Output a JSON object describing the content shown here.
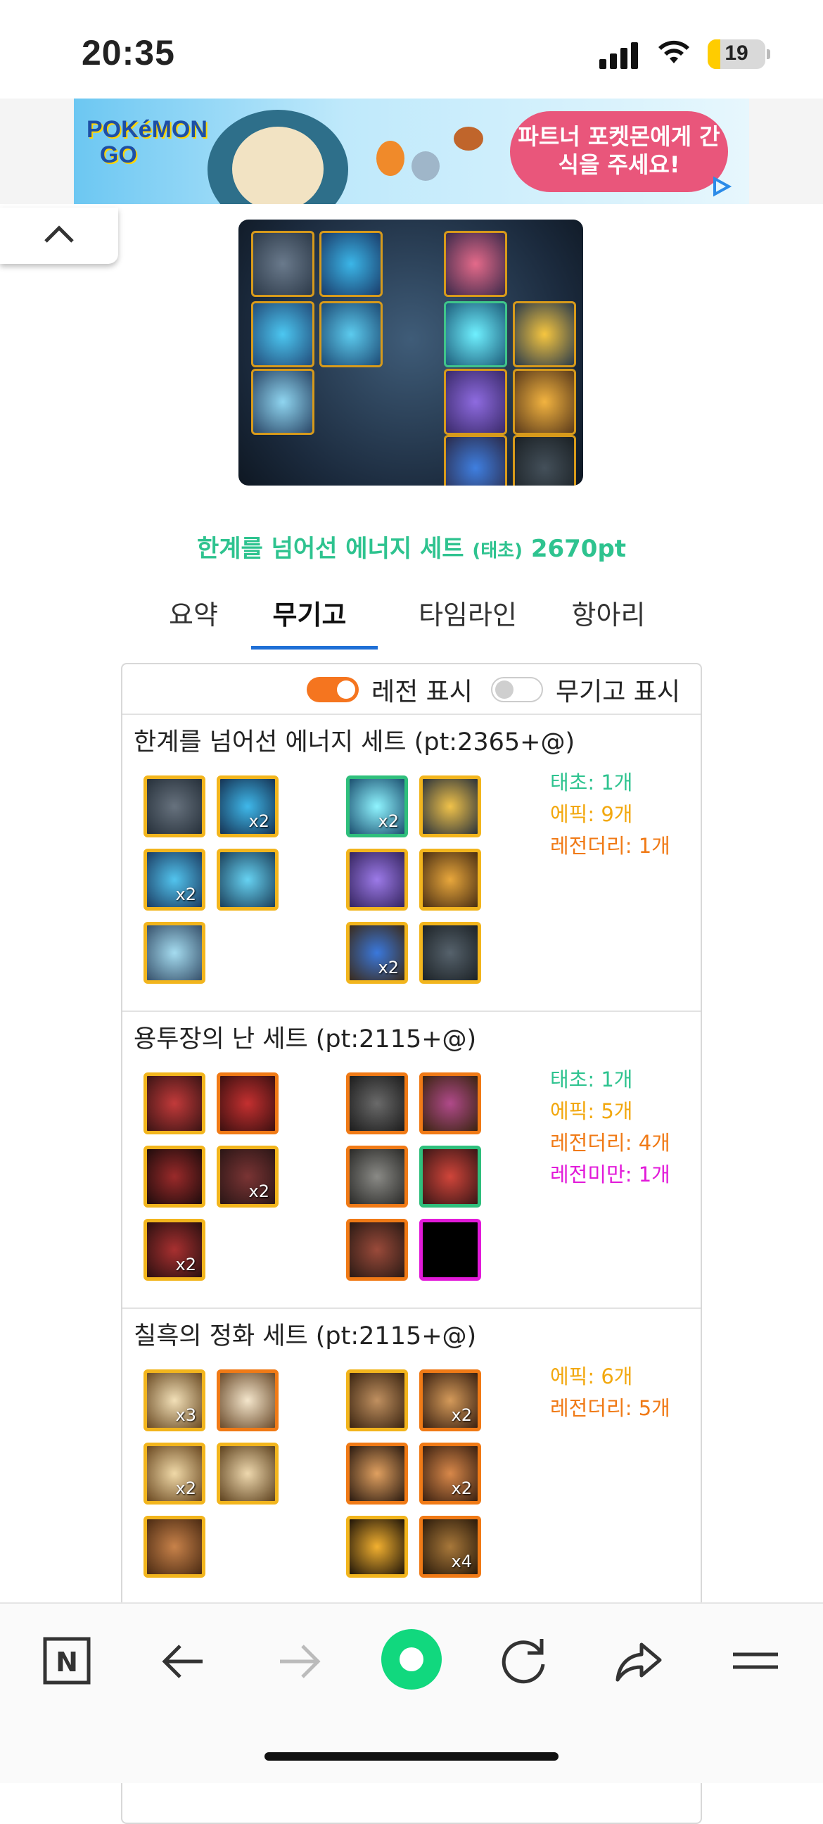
{
  "status_bar": {
    "time": "20:35",
    "battery": "19"
  },
  "ad": {
    "brand": "POKéMON GO",
    "headline": "파트너 포켓몬에게 간식을 주세요!"
  },
  "hero": {
    "set_name": "한계를 넘어선 에너지 세트",
    "grade": "(태초)",
    "points": "2670pt"
  },
  "tabs": [
    {
      "label": "요약"
    },
    {
      "label": "무기고"
    },
    {
      "label": "타임라인"
    },
    {
      "label": "항아리"
    }
  ],
  "toggles": {
    "legend_label": "레전 표시",
    "legend_on": true,
    "armory_label": "무기고 표시",
    "armory_on": false
  },
  "sets": [
    {
      "title": "한계를 넘어선 에너지 세트 (pt:2365+@)",
      "left_items": [
        {
          "icon": "dark-shoulder-icon",
          "count": ""
        },
        {
          "icon": "blue-armor-top-icon",
          "count": "x2"
        },
        {
          "icon": "blue-pants-icon",
          "count": "x2"
        },
        {
          "icon": "blue-belt-icon",
          "count": ""
        },
        {
          "icon": "blue-shoes-icon",
          "count": ""
        }
      ],
      "right_items": [
        {
          "icon": "orb-bracelet-icon",
          "count": "x2",
          "rarity": "primeval"
        },
        {
          "icon": "gold-necklace-icon",
          "count": ""
        },
        {
          "icon": "purple-stone-icon",
          "count": ""
        },
        {
          "icon": "gold-ring-icon",
          "count": ""
        },
        {
          "icon": "blue-support-icon",
          "count": "x2"
        },
        {
          "icon": "dark-magic-stone-icon",
          "count": ""
        }
      ],
      "stats": [
        {
          "label": "태초: 1개",
          "color": "#2ec38f"
        },
        {
          "label": "에픽: 9개",
          "color": "#f2a80f"
        },
        {
          "label": "레전더리: 1개",
          "color": "#f07a16"
        }
      ]
    },
    {
      "title": "용투장의 난 세트 (pt:2115+@)",
      "left_items": [
        {
          "icon": "red-shoulder-icon",
          "count": ""
        },
        {
          "icon": "red-armor-top-icon",
          "count": ""
        },
        {
          "icon": "red-pants-icon",
          "count": ""
        },
        {
          "icon": "red-belt-icon",
          "count": "x2"
        },
        {
          "icon": "red-shoes-icon",
          "count": "x2"
        }
      ],
      "right_items": [
        {
          "icon": "dark-bracelet-icon",
          "count": ""
        },
        {
          "icon": "star-necklace-icon",
          "count": ""
        },
        {
          "icon": "horn-ring-icon",
          "count": ""
        },
        {
          "icon": "red-ring-icon",
          "count": "",
          "rarity": "primeval"
        },
        {
          "icon": "claw-support-icon",
          "count": ""
        },
        {
          "icon": "empty-slot-icon",
          "count": "",
          "rarity": "unique"
        }
      ],
      "stats": [
        {
          "label": "태초: 1개",
          "color": "#2ec38f"
        },
        {
          "label": "에픽: 5개",
          "color": "#f2a80f"
        },
        {
          "label": "레전더리: 4개",
          "color": "#f07a16"
        },
        {
          "label": "레전미만: 1개",
          "color": "#e21ad9"
        }
      ]
    },
    {
      "title": "칠흑의 정화 세트 (pt:2115+@)",
      "left_items": [
        {
          "icon": "white-shoulder-icon",
          "count": "x3"
        },
        {
          "icon": "white-armor-top-icon",
          "count": ""
        },
        {
          "icon": "white-pants-icon",
          "count": "x2"
        },
        {
          "icon": "white-belt-icon",
          "count": ""
        },
        {
          "icon": "brown-shoes-icon",
          "count": ""
        }
      ],
      "right_items": [
        {
          "icon": "rose-bracelet-icon",
          "count": ""
        },
        {
          "icon": "acorn-necklace-icon",
          "count": "x2"
        },
        {
          "icon": "lamp-ring-icon",
          "count": ""
        },
        {
          "icon": "leaf-ring-icon",
          "count": "x2"
        },
        {
          "icon": "spider-support-icon",
          "count": ""
        },
        {
          "icon": "leaf-stone-icon",
          "count": "x4"
        }
      ],
      "stats": [
        {
          "label": "에픽: 6개",
          "color": "#f2a80f"
        },
        {
          "label": "레전더리: 5개",
          "color": "#f07a16"
        }
      ]
    }
  ],
  "bottom_nav": {
    "home_letter": "N"
  }
}
